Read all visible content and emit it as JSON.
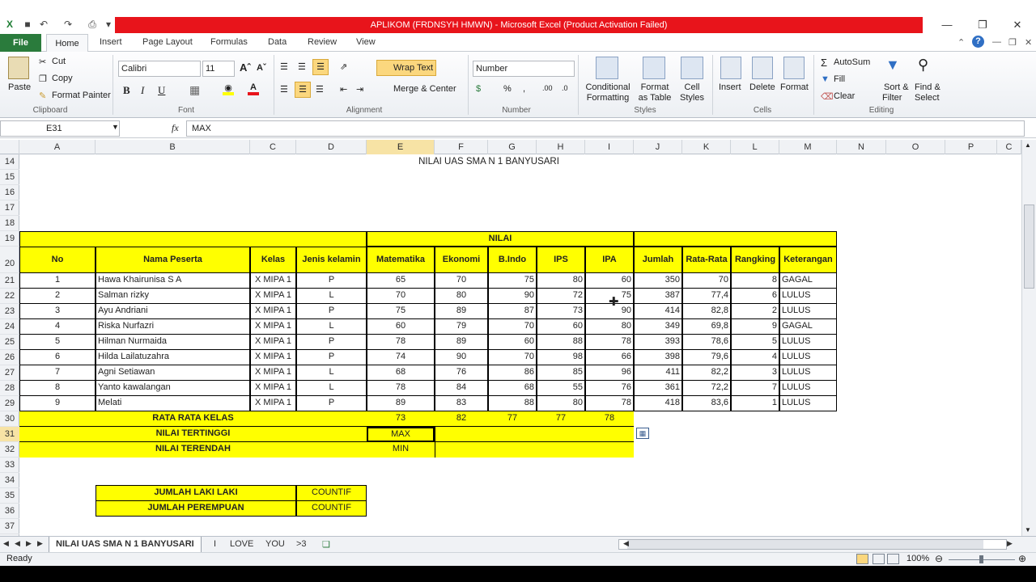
{
  "window": {
    "title": "APLIKOM (FRDNSYH HMWN)  -  Microsoft Excel (Product Activation Failed)"
  },
  "menu": {
    "file": "File",
    "tabs": [
      "Home",
      "Insert",
      "Page Layout",
      "Formulas",
      "Data",
      "Review",
      "View"
    ]
  },
  "ribbon": {
    "clipboard": {
      "paste": "Paste",
      "cut": "Cut",
      "copy": "Copy",
      "format_painter": "Format Painter",
      "label": "Clipboard"
    },
    "font": {
      "name": "Calibri",
      "size": "11",
      "label": "Font"
    },
    "alignment": {
      "wrap_text": "Wrap Text",
      "merge_center": "Merge & Center",
      "label": "Alignment"
    },
    "number": {
      "format": "Number",
      "label": "Number"
    },
    "styles": {
      "conditional": "Conditional",
      "conditional2": "Formatting",
      "format_as": "Format",
      "format_as2": "as Table",
      "cell": "Cell",
      "cell2": "Styles",
      "label": "Styles"
    },
    "cells": {
      "insert": "Insert",
      "delete": "Delete",
      "format": "Format",
      "label": "Cells"
    },
    "editing": {
      "autosum": "AutoSum",
      "fill": "Fill",
      "clear": "Clear",
      "sort": "Sort &",
      "sort2": "Filter",
      "find": "Find &",
      "find2": "Select",
      "label": "Editing"
    }
  },
  "formula_bar": {
    "name_box": "E31",
    "fx": "fx",
    "content": "MAX"
  },
  "columns": [
    "A",
    "B",
    "C",
    "D",
    "E",
    "F",
    "G",
    "H",
    "I",
    "J",
    "K",
    "L",
    "M",
    "N",
    "O",
    "P",
    "C"
  ],
  "rows": [
    "14",
    "15",
    "16",
    "17",
    "18",
    "19",
    "20",
    "21",
    "22",
    "23",
    "24",
    "25",
    "26",
    "27",
    "28",
    "29",
    "30",
    "31",
    "32",
    "33",
    "34",
    "35",
    "36",
    "37"
  ],
  "sheet": {
    "title": "NILAI UAS SMA N 1 BANYUSARI",
    "nilai_header": "NILAI",
    "headers": [
      "No",
      "Nama Peserta",
      "Kelas",
      "Jenis kelamin",
      "Matematika",
      "Ekonomi",
      "B.Indo",
      "IPS",
      "IPA",
      "Jumlah",
      "Rata-Rata",
      "Rangking",
      "Keterangan"
    ],
    "students": [
      [
        "1",
        "Hawa Khairunisa S A",
        "X MIPA 1",
        "P",
        "65",
        "70",
        "75",
        "80",
        "60",
        "350",
        "70",
        "8",
        "GAGAL"
      ],
      [
        "2",
        "Salman rizky",
        "X MIPA 1",
        "L",
        "70",
        "80",
        "90",
        "72",
        "75",
        "387",
        "77,4",
        "6",
        "LULUS"
      ],
      [
        "3",
        "Ayu Andriani",
        "X MIPA 1",
        "P",
        "75",
        "89",
        "87",
        "73",
        "90",
        "414",
        "82,8",
        "2",
        "LULUS"
      ],
      [
        "4",
        "Riska Nurfazri",
        "X MIPA 1",
        "L",
        "60",
        "79",
        "70",
        "60",
        "80",
        "349",
        "69,8",
        "9",
        "GAGAL"
      ],
      [
        "5",
        "Hilman Nurmaida",
        "X MIPA 1",
        "P",
        "78",
        "89",
        "60",
        "88",
        "78",
        "393",
        "78,6",
        "5",
        "LULUS"
      ],
      [
        "6",
        "Hilda Lailatuzahra",
        "X MIPA 1",
        "P",
        "74",
        "90",
        "70",
        "98",
        "66",
        "398",
        "79,6",
        "4",
        "LULUS"
      ],
      [
        "7",
        "Agni Setiawan",
        "X MIPA 1",
        "L",
        "68",
        "76",
        "86",
        "85",
        "96",
        "411",
        "82,2",
        "3",
        "LULUS"
      ],
      [
        "8",
        "Yanto kawalangan",
        "X MIPA 1",
        "L",
        "78",
        "84",
        "68",
        "55",
        "76",
        "361",
        "72,2",
        "7",
        "LULUS"
      ],
      [
        "9",
        "Melati",
        "X MIPA 1",
        "P",
        "89",
        "83",
        "88",
        "80",
        "78",
        "418",
        "83,6",
        "1",
        "LULUS"
      ]
    ],
    "rata_label": "RATA RATA KELAS",
    "rata_values": [
      "73",
      "82",
      "77",
      "77",
      "78"
    ],
    "tertinggi_label": "NILAI TERTINGGI",
    "tertinggi_value": "MAX",
    "terendah_label": "NILAI TERENDAH",
    "terendah_value": "MIN",
    "laki_label": "JUMLAH LAKI LAKI",
    "laki_value": "COUNTIF",
    "perempuan_label": "JUMLAH PEREMPUAN",
    "perempuan_value": "COUNTIF"
  },
  "sheet_tabs": [
    "NILAI UAS SMA N 1 BANYUSARI",
    "I",
    "LOVE",
    "YOU",
    ">3"
  ],
  "status": {
    "ready": "Ready",
    "zoom": "100%"
  },
  "colors": {
    "yellow": "#ffff00",
    "file_tab": "#2a7b3c",
    "title_red": "#e8141b",
    "selected_header": "#f7e3a5"
  }
}
